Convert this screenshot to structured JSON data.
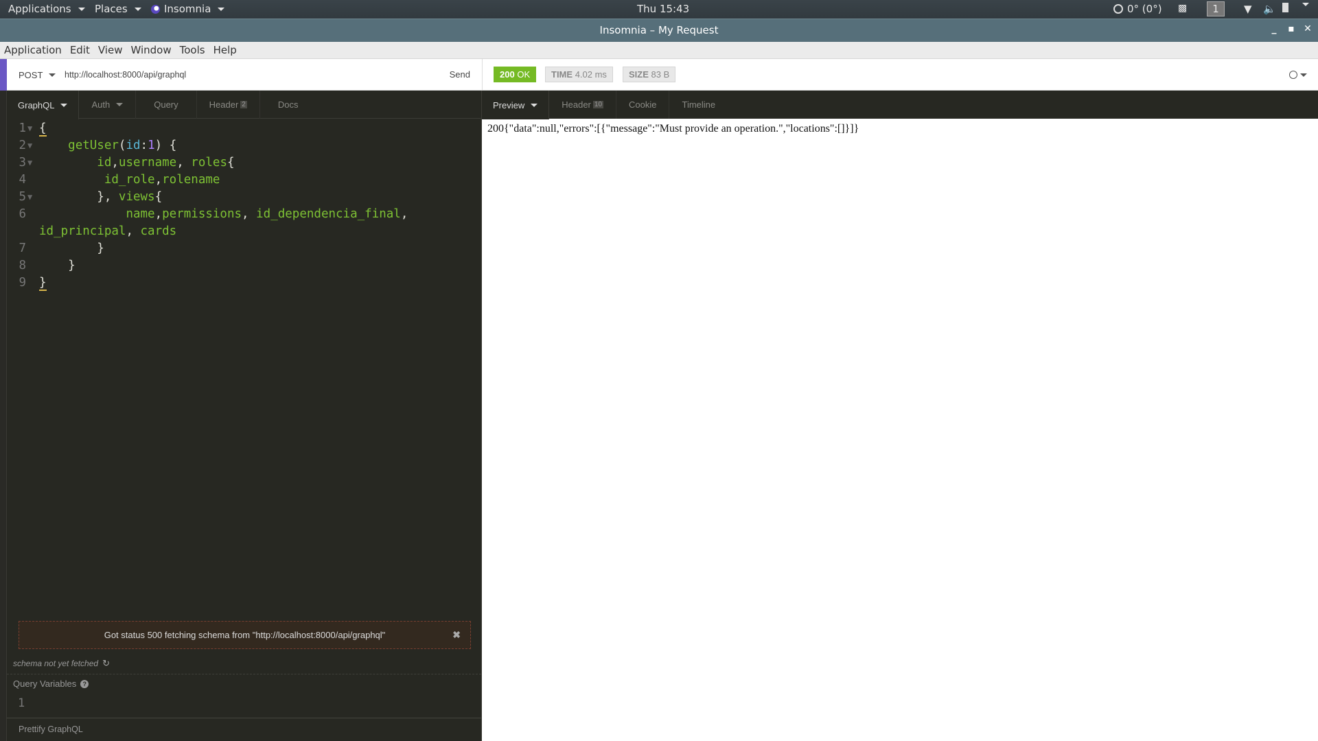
{
  "system_bar": {
    "applications": "Applications",
    "places": "Places",
    "app_menu": "Insomnia",
    "clock": "Thu 15:43",
    "orientation": "0° (0°)",
    "workspace": "1"
  },
  "window": {
    "title": "Insomnia – My Request"
  },
  "menu": [
    "Application",
    "Edit",
    "View",
    "Window",
    "Tools",
    "Help"
  ],
  "request": {
    "method": "POST",
    "url": "http://localhost:8000/api/graphql",
    "send_label": "Send",
    "tabs": [
      {
        "label": "GraphQL",
        "active": true,
        "caret": true
      },
      {
        "label": "Auth",
        "caret": true
      },
      {
        "label": "Query"
      },
      {
        "label": "Header",
        "count": "2"
      },
      {
        "label": "Docs"
      }
    ]
  },
  "response": {
    "status_code": "200",
    "status_text": "OK",
    "time_label": "TIME",
    "time_value": "4.02 ms",
    "size_label": "SIZE",
    "size_value": "83 B",
    "tabs": [
      {
        "label": "Preview",
        "active": true,
        "caret": true
      },
      {
        "label": "Header",
        "count": "10"
      },
      {
        "label": "Cookie"
      },
      {
        "label": "Timeline"
      }
    ],
    "body": "200{\"data\":null,\"errors\":[{\"message\":\"Must provide an operation.\",\"locations\":[]}]}"
  },
  "editor": {
    "line_numbers": [
      "1",
      "2",
      "3",
      "4",
      "5",
      "6",
      "",
      "7",
      "8",
      "9"
    ],
    "lines": [
      "{",
      "    getUser(id:1) {",
      "        id,username, roles{",
      "         id_role,rolename",
      "        }, views{",
      "            name,permissions, id_dependencia_final,",
      "id_principal, cards",
      "        }",
      "    }",
      "}"
    ]
  },
  "schema": {
    "error": "Got status 500 fetching schema from \"http://localhost:8000/api/graphql\"",
    "status": "schema not yet fetched",
    "query_variables_label": "Query Variables",
    "query_variables_line": "1",
    "prettify_label": "Prettify GraphQL"
  }
}
